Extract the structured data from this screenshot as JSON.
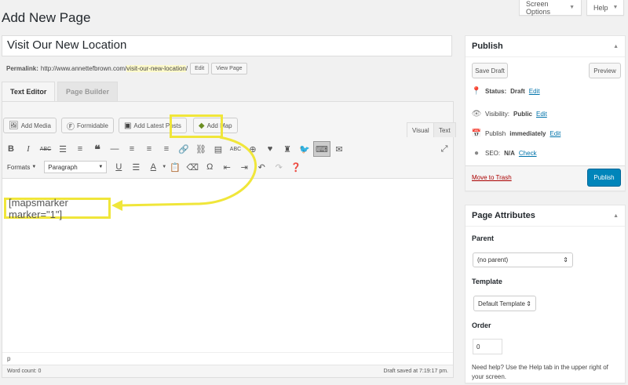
{
  "header": {
    "title": "Add New Page",
    "screen_options": "Screen Options",
    "help": "Help"
  },
  "title_field": {
    "value": "Visit Our New Location"
  },
  "permalink": {
    "label": "Permalink:",
    "base": "http://www.annettefbrown.com/",
    "slug": "visit-our-new-location",
    "trail": "/",
    "edit": "Edit",
    "view": "View Page"
  },
  "builder_tabs": [
    "Text Editor",
    "Page Builder"
  ],
  "media_buttons": [
    "Add Media",
    "Formidable",
    "Add Latest Posts",
    "Add Map"
  ],
  "mode_tabs": {
    "visual": "Visual",
    "text": "Text"
  },
  "toolbar": {
    "formats": "Formats",
    "paragraph": "Paragraph"
  },
  "content": {
    "shortcode": "[mapsmarker marker=\"1\"]"
  },
  "path": "p",
  "status": {
    "word_count": "Word count: 0",
    "draft_saved": "Draft saved at 7:19:17 pm."
  },
  "publish_box": {
    "title": "Publish",
    "save_draft": "Save Draft",
    "preview": "Preview",
    "status_label": "Status:",
    "status_value": "Draft",
    "visibility_label": "Visibility:",
    "visibility_value": "Public",
    "publish_label": "Publish",
    "publish_value": "immediately",
    "seo_label": "SEO:",
    "seo_value": "N/A",
    "edit": "Edit",
    "check": "Check",
    "trash": "Move to Trash",
    "publish_button": "Publish"
  },
  "page_attributes": {
    "title": "Page Attributes",
    "parent_label": "Parent",
    "parent_value": "(no parent)",
    "template_label": "Template",
    "template_value": "Default Template",
    "order_label": "Order",
    "order_value": "0",
    "help": "Need help? Use the Help tab in the upper right of your screen."
  },
  "colors": {
    "highlight": "#f0e63a",
    "link": "#0073aa",
    "primary": "#0085ba",
    "trash": "#aa0000"
  }
}
